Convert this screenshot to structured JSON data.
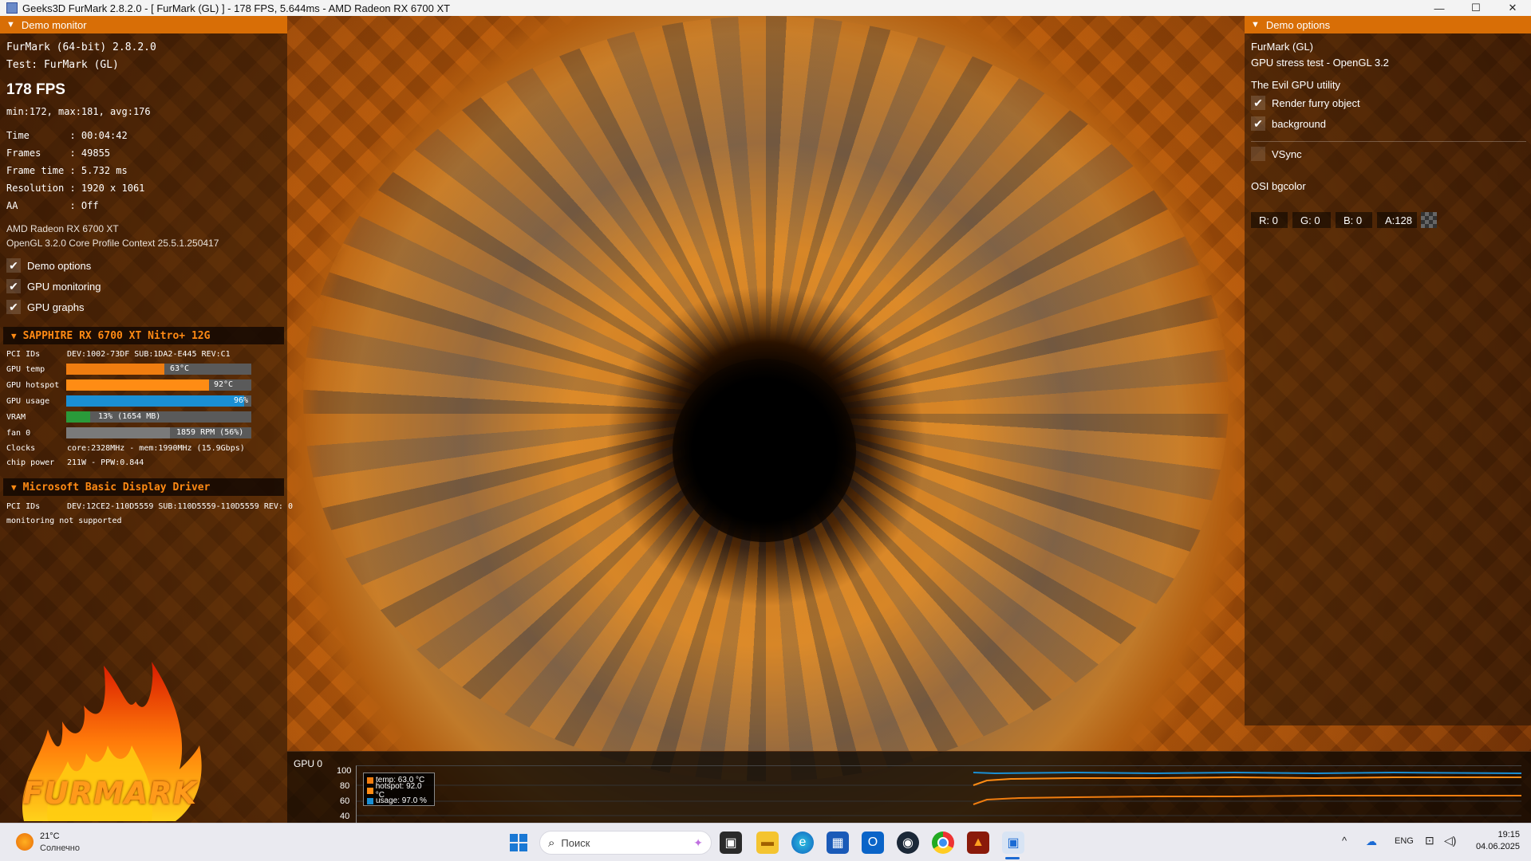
{
  "window": {
    "title": "Geeks3D FurMark 2.8.2.0 - [ FurMark (GL) ] - 178 FPS, 5.644ms - AMD Radeon RX 6700 XT",
    "controls": [
      "—",
      "☐",
      "✕"
    ]
  },
  "demo_monitor": {
    "header": "Demo monitor",
    "app_line": "FurMark (64-bit) 2.8.2.0",
    "test_line": "Test: FurMark (GL)",
    "fps": "178 FPS",
    "fps_stats": "min:172, max:181, avg:176",
    "stats": [
      {
        "label": "Time       : 00:04:42"
      },
      {
        "label": "Frames     : 49855"
      },
      {
        "label": "Frame time : 5.732 ms"
      },
      {
        "label": "Resolution : 1920 x 1061"
      },
      {
        "label": "AA         : Off"
      }
    ],
    "gpu_name": "AMD Radeon RX 6700 XT",
    "gl_context": "OpenGL 3.2.0 Core Profile Context 25.5.1.250417",
    "checkboxes": [
      {
        "label": "Demo options",
        "checked": true
      },
      {
        "label": "GPU monitoring",
        "checked": true
      },
      {
        "label": "GPU graphs",
        "checked": true
      }
    ]
  },
  "gpu0": {
    "header": "SAPPHIRE RX 6700 XT Nitro+ 12G",
    "pci_label": "PCI IDs",
    "pci_value": "DEV:1002-73DF SUB:1DA2-E445 REV:C1",
    "temp_label": "GPU temp",
    "temp_value": "63°C",
    "temp_fraction": 0.53,
    "hotspot_label": "GPU hotspot",
    "hotspot_value": "92°C",
    "hotspot_fraction": 0.77,
    "usage_label": "GPU usage",
    "usage_value": "96%",
    "usage_fraction": 0.96,
    "vram_label": "VRAM",
    "vram_value": "13% (1654 MB)",
    "vram_fraction": 0.13,
    "fan_label": "fan 0",
    "fan_value": "1859 RPM (56%)",
    "fan_fraction": 0.56,
    "clocks_label": "Clocks",
    "clocks_value": "core:2328MHz - mem:1990MHz (15.9Gbps)",
    "power_label": "chip power",
    "power_value": "211W - PPW:0.844",
    "colors": {
      "temp": "#f07d10",
      "hotspot": "#ff8c14",
      "usage": "#1a8fd4",
      "vram": "#2a9a3a",
      "fan": "#7a7a7a"
    }
  },
  "gpu1": {
    "header": "Microsoft Basic Display Driver",
    "pci_label": "PCI IDs",
    "pci_value": "DEV:12CE2-110D5559 SUB:110D5559-110D5559 REV: 0",
    "monitoring": "monitoring not supported"
  },
  "logo": {
    "text": "FURMARK"
  },
  "demo_options": {
    "header": "Demo options",
    "name": "FurMark (GL)",
    "desc": "GPU stress test - OpenGL 3.2",
    "section": "The Evil GPU utility",
    "checkboxes": [
      {
        "label": "Render furry object",
        "checked": true
      },
      {
        "label": "background",
        "checked": true
      },
      {
        "label": "VSync",
        "checked": false
      }
    ],
    "bgcolor_label": "OSI bgcolor",
    "r": "R: 0",
    "g": "G: 0",
    "b": "B: 0",
    "a": "A:128"
  },
  "graph": {
    "title": "GPU 0",
    "y_ticks": [
      "100",
      "80",
      "60",
      "40"
    ],
    "legend": [
      {
        "label": "temp: 63.0 °C",
        "color": "#f07d10"
      },
      {
        "label": "hotspot: 92.0 °C",
        "color": "#ff8c14"
      },
      {
        "label": "usage: 97.0 %",
        "color": "#1a8fd4"
      }
    ]
  },
  "taskbar": {
    "weather_temp": "21°C",
    "weather_text": "Солнечно",
    "search_placeholder": "Поиск",
    "lang": "ENG",
    "time": "19:15",
    "date": "04.06.2025"
  }
}
